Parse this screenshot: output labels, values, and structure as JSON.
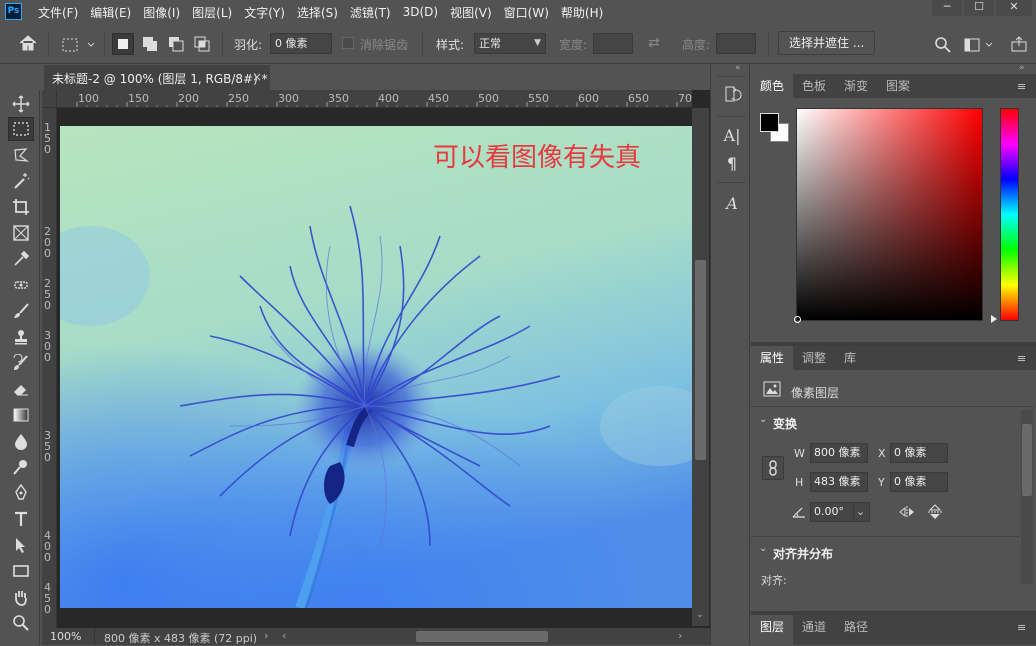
{
  "app": {
    "logo": "Ps"
  },
  "menu": [
    "文件(F)",
    "编辑(E)",
    "图像(I)",
    "图层(L)",
    "文字(Y)",
    "选择(S)",
    "滤镜(T)",
    "3D(D)",
    "视图(V)",
    "窗口(W)",
    "帮助(H)"
  ],
  "options": {
    "feather_label": "羽化:",
    "feather_value": "0 像素",
    "antialias_label": "消除锯齿",
    "style_label": "样式:",
    "style_value": "正常",
    "width_label": "宽度:",
    "height_label": "高度:",
    "select_mask_button": "选择并遮住 ..."
  },
  "document": {
    "tab_title": "未标题-2 @ 100% (图层 1, RGB/8#) *",
    "overlay_text": "可以看图像有失真",
    "zoom": "100%",
    "doc_info": "800 像素 x 483 像素 (72 ppi)",
    "ruler_h": [
      "100",
      "150",
      "200",
      "250",
      "300",
      "350",
      "400",
      "450",
      "500",
      "550",
      "600",
      "650",
      "70"
    ],
    "ruler_v": [
      "1 5 0",
      "2 0 0",
      "2 5 0",
      "3 0 0",
      "3 5 0",
      "4 0 0",
      "4 5 0"
    ]
  },
  "color_panel": {
    "tabs": [
      "颜色",
      "色板",
      "渐变",
      "图案"
    ],
    "foreground": "#000000",
    "background": "#ffffff",
    "hue_color": "#ff0000"
  },
  "properties": {
    "tabs": [
      "属性",
      "调整",
      "库"
    ],
    "layer_type": "像素图层",
    "transform_title": "变换",
    "w_label": "W",
    "w_value": "800 像素",
    "h_label": "H",
    "h_value": "483 像素",
    "x_label": "X",
    "x_value": "0 像素",
    "y_label": "Y",
    "y_value": "0 像素",
    "angle_value": "0.00°",
    "align_title": "对齐并分布",
    "align_label": "对齐:"
  },
  "layers_panel": {
    "tabs": [
      "图层",
      "通道",
      "路径"
    ]
  }
}
